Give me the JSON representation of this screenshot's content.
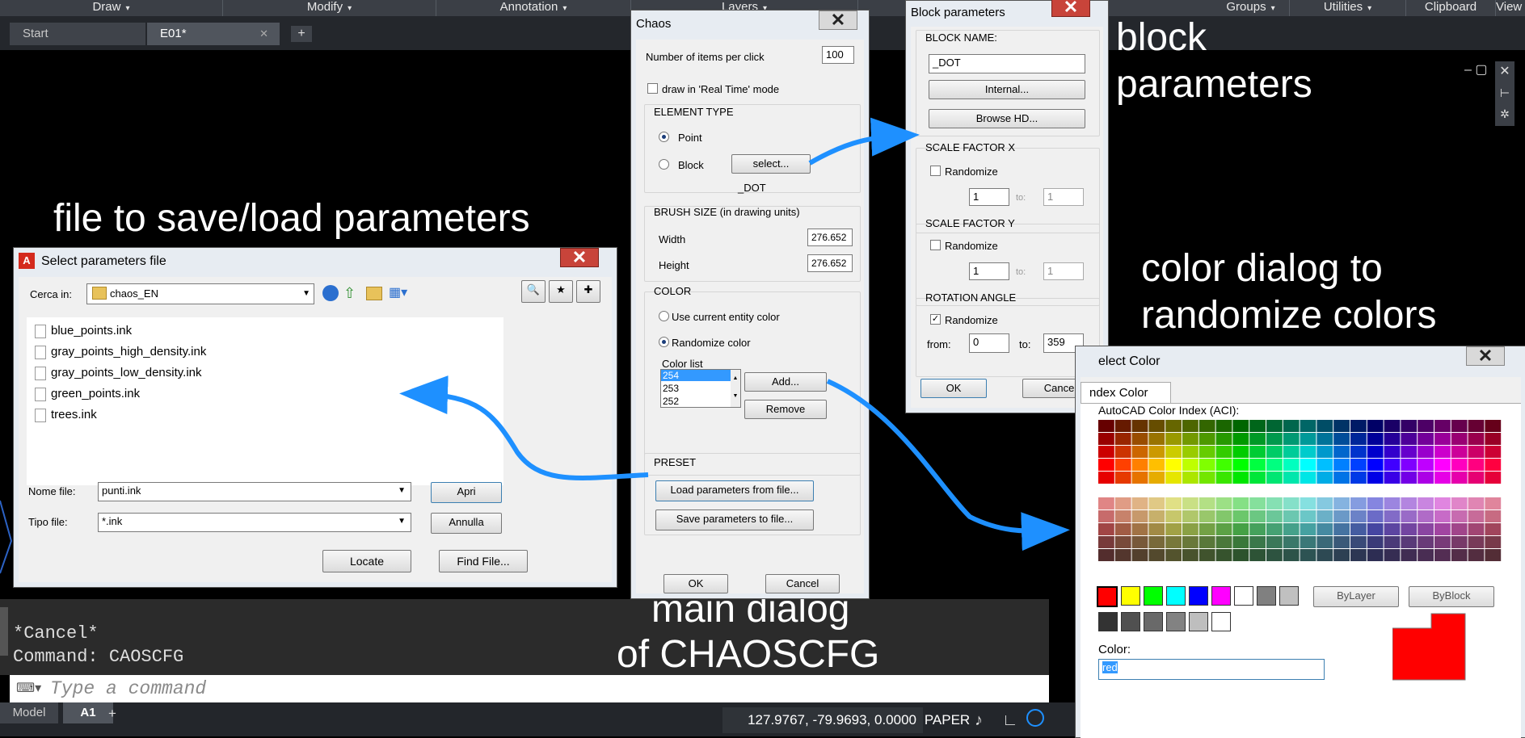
{
  "ribbon": {
    "panels": [
      {
        "label": "Draw",
        "arrow": "▾"
      },
      {
        "label": "Modify",
        "arrow": "▾"
      },
      {
        "label": "Annotation",
        "arrow": "▾"
      },
      {
        "label": "Layers",
        "arrow": "▾"
      },
      {
        "label": "Groups",
        "arrow": "▾"
      },
      {
        "label": "Utilities",
        "arrow": "▾"
      },
      {
        "label": "Clipboard",
        "arrow": ""
      },
      {
        "label": "View",
        "arrow": ""
      }
    ]
  },
  "file_tabs": [
    {
      "label": "Start"
    },
    {
      "label": "E01*",
      "close": "✕"
    }
  ],
  "annotations": {
    "file_params": "file to save/load parameters",
    "block_params_1": "block",
    "block_params_2": "parameters",
    "color_dialog_1": "color dialog to",
    "color_dialog_2": "randomize colors",
    "main_dialog_1": "main dialog",
    "main_dialog_2": "of CHAOSCFG"
  },
  "command_line": {
    "history": [
      "*Cancel*",
      "Command: CAOSCFG"
    ],
    "placeholder": "Type a command"
  },
  "status_bar": {
    "layout_tabs": [
      "Model",
      "A1"
    ],
    "coordinates": "127.9767, -79.9693, 0.0000",
    "space": "PAPER"
  },
  "file_dialog": {
    "title": "Select parameters file",
    "look_in_label": "Cerca in:",
    "look_in_value": "chaos_EN",
    "files": [
      "blue_points.ink",
      "gray_points_high_density.ink",
      "gray_points_low_density.ink",
      "green_points.ink",
      "trees.ink"
    ],
    "filename_label": "Nome file:",
    "filename_value": "punti.ink",
    "filetype_label": "Tipo file:",
    "filetype_value": "*.ink",
    "open_button": "Apri",
    "cancel_button": "Annulla",
    "locate_button": "Locate",
    "find_button": "Find File..."
  },
  "chaos_dialog": {
    "title": "Chaos",
    "items_per_click_label": "Number of items per click",
    "items_per_click_value": "100",
    "realtime_label": "draw in 'Real Time' mode",
    "element_type_label": "ELEMENT TYPE",
    "point_label": "Point",
    "block_label": "Block",
    "select_button": "select...",
    "block_name": "_DOT",
    "brush_size_label": "BRUSH SIZE (in drawing units)",
    "width_label": "Width",
    "width_value": "276.652",
    "height_label": "Height",
    "height_value": "276.652",
    "color_label": "COLOR",
    "use_current_label": "Use current entity color",
    "randomize_label": "Randomize color",
    "color_list_label": "Color list",
    "color_list": [
      "254",
      "253",
      "252"
    ],
    "add_button": "Add...",
    "remove_button": "Remove",
    "preset_label": "PRESET",
    "load_button": "Load parameters from file...",
    "save_button": "Save parameters to file...",
    "ok_button": "OK",
    "cancel_button": "Cancel"
  },
  "block_dialog": {
    "title": "Block parameters",
    "block_name_label": "BLOCK NAME:",
    "block_name_value": "_DOT",
    "internal_button": "Internal...",
    "browse_button": "Browse HD...",
    "scale_x_label": "SCALE FACTOR X",
    "scale_y_label": "SCALE FACTOR Y",
    "rotation_label": "ROTATION ANGLE",
    "randomize_label": "Randomize",
    "to_label": "to:",
    "from_label": "from:",
    "sx_from": "1",
    "sx_to": "1",
    "sy_from": "1",
    "sy_to": "1",
    "rot_from": "0",
    "rot_to": "359",
    "ok_button": "OK",
    "cancel_button": "Cancel"
  },
  "color_dialog": {
    "title": "elect Color",
    "tab_label": "ndex Color",
    "aci_label": "AutoCAD Color Index (ACI):",
    "bylayer_button": "ByLayer",
    "byblock_button": "ByBlock",
    "color_label": "Color:",
    "color_value": "red",
    "selected_color": "#ff0000"
  },
  "colors": {
    "accent_arrow": "#1e90ff",
    "selection": "#3399ff"
  }
}
